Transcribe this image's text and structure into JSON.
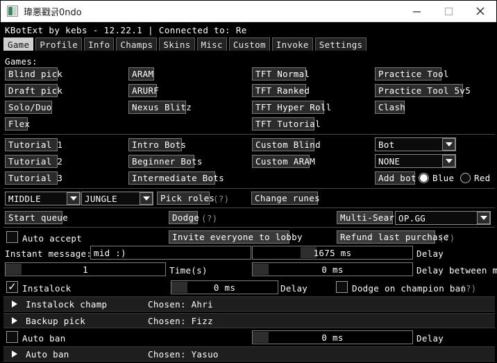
{
  "window": {
    "title": "瑋悪戳긁0ndo",
    "icon": "app-icon",
    "minimize": "—",
    "maximize": "□",
    "close": "✕"
  },
  "statusbar": {
    "text": "KBotExt by kebs - 12.22.1 | Connected to: Re"
  },
  "tabs": [
    {
      "label": "Game",
      "active": true
    },
    {
      "label": "Profile",
      "active": false
    },
    {
      "label": "Info",
      "active": false
    },
    {
      "label": "Champs",
      "active": false
    },
    {
      "label": "Skins",
      "active": false
    },
    {
      "label": "Misc",
      "active": false
    },
    {
      "label": "Custom",
      "active": false
    },
    {
      "label": "Invoke",
      "active": false
    },
    {
      "label": "Settings",
      "active": false
    }
  ],
  "game": {
    "games_label": "Games:",
    "queue_buttons": {
      "col1": [
        "Blind pick",
        "Draft pick",
        "Solo/Duo",
        "Flex"
      ],
      "col2": [
        "ARAM",
        "ARURF",
        "Nexus Blitz"
      ],
      "col3": [
        "TFT Normal",
        "TFT Ranked",
        "TFT Hyper Roll",
        "TFT Tutorial"
      ],
      "col4": [
        "Practice Tool",
        "Practice Tool 5v5",
        "Clash"
      ]
    },
    "tutorial_buttons": [
      "Tutorial 1",
      "Tutorial 2",
      "Tutorial 3"
    ],
    "bot_buttons": [
      "Intro Bots",
      "Beginner Bots",
      "Intermediate Bots"
    ],
    "custom_buttons": [
      "Custom Blind",
      "Custom ARAM"
    ],
    "bot_dropdown": {
      "value": "Bot"
    },
    "difficulty_dropdown": {
      "value": "NONE"
    },
    "add_bot_button": "Add bot",
    "team_blue": {
      "label": "Blue",
      "selected": true
    },
    "team_red": {
      "label": "Red",
      "selected": false
    },
    "role_primary": {
      "value": "MIDDLE"
    },
    "role_secondary": {
      "value": "JUNGLE"
    },
    "pick_roles_button": "Pick roles",
    "pick_roles_help": "(?)",
    "change_runes_button": "Change runes",
    "start_queue_button": "Start queue",
    "dodge_button": "Dodge",
    "dodge_help": "(?)",
    "multi_search_button": "Multi-Search",
    "multi_search_dropdown": {
      "value": "OP.GG"
    },
    "auto_accept": {
      "label": "Auto accept",
      "checked": false
    },
    "invite_everyone_button": "Invite everyone to lobby",
    "refund_button": "Refund last purchase",
    "refund_help": "(?)",
    "instant_message_label": "Instant message:",
    "instant_message_value": "mid :)",
    "msg_delay_slider": {
      "value": "1675 ms",
      "label": "Delay",
      "pct": 30
    },
    "msg_between_slider": {
      "value": "0 ms",
      "label": "Delay between msg",
      "pct": 0
    },
    "times_slider": {
      "value": "1",
      "label": "Time(s)",
      "pct": 0
    },
    "instalock": {
      "label": "Instalock",
      "checked": true
    },
    "instalock_delay_slider": {
      "value": "0 ms",
      "label": "Delay",
      "pct": 0
    },
    "dodge_on_ban": {
      "label": "Dodge on champion ban",
      "checked": false,
      "help": "(?)"
    },
    "instalock_champ_row": {
      "name": "Instalock champ",
      "chosen": "Chosen: Ahri",
      "expanded": false
    },
    "backup_pick_row": {
      "name": "Backup pick",
      "chosen": "Chosen: Fizz",
      "expanded": false
    },
    "auto_ban": {
      "label": "Auto ban",
      "checked": false
    },
    "auto_ban_delay_slider": {
      "value": "0 ms",
      "label": "Delay",
      "pct": 0
    },
    "auto_ban_row": {
      "name": "Auto ban",
      "chosen": "Chosen: Yasuo",
      "expanded": false
    }
  },
  "colors": {
    "background": "#000000",
    "titlebar": "#ffffff",
    "accent_tab": "#cfcfcf",
    "border": "#7a7a7a",
    "text": "#ffffff",
    "dim_text": "#8e8e8e"
  }
}
